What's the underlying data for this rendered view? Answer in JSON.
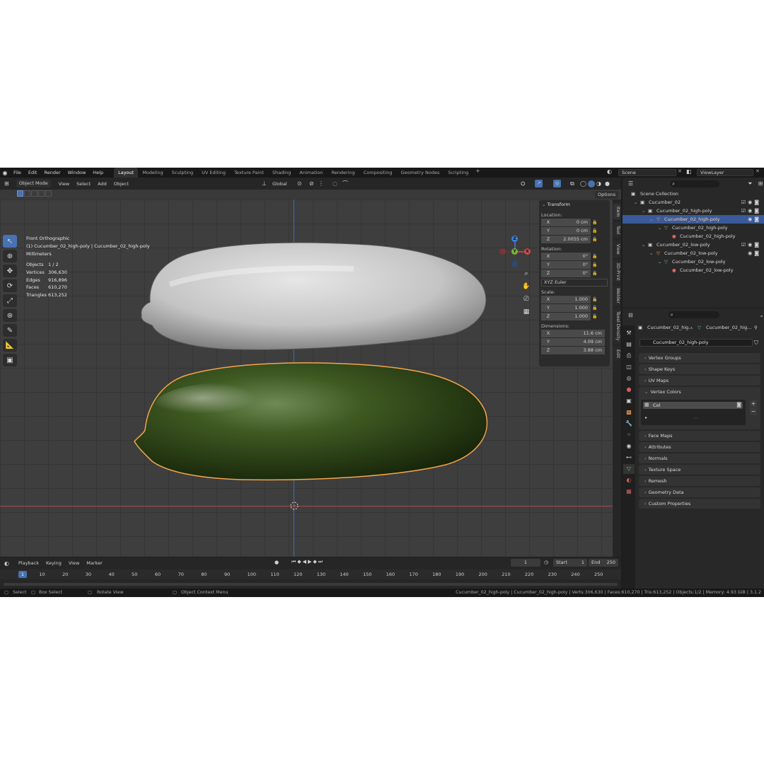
{
  "topbar": {
    "menus": [
      "File",
      "Edit",
      "Render",
      "Window",
      "Help"
    ],
    "workspaces": [
      {
        "label": "Layout",
        "active": true
      },
      {
        "label": "Modeling",
        "active": false
      },
      {
        "label": "Sculpting",
        "active": false
      },
      {
        "label": "UV Editing",
        "active": false
      },
      {
        "label": "Texture Paint",
        "active": false
      },
      {
        "label": "Shading",
        "active": false
      },
      {
        "label": "Animation",
        "active": false
      },
      {
        "label": "Rendering",
        "active": false
      },
      {
        "label": "Compositing",
        "active": false
      },
      {
        "label": "Geometry Nodes",
        "active": false
      },
      {
        "label": "Scripting",
        "active": false
      }
    ],
    "add_tab": "+",
    "scene": "Scene",
    "view_layer": "ViewLayer"
  },
  "viewport_header": {
    "mode": "Object Mode",
    "menus": [
      "View",
      "Select",
      "Add",
      "Object"
    ],
    "orientation": "Global",
    "options": "Options"
  },
  "viewport": {
    "view_name": "Front Orthographic",
    "object_line": "(1) Cucumber_02_high-poly | Cucumber_02_high-poly",
    "units": "Millimeters",
    "stats": [
      {
        "key": "Objects",
        "value": "1 / 2"
      },
      {
        "key": "Vertices",
        "value": "306,630"
      },
      {
        "key": "Edges",
        "value": "916,896"
      },
      {
        "key": "Faces",
        "value": "610,270"
      },
      {
        "key": "Triangles",
        "value": "613,252"
      }
    ],
    "gizmo": {
      "z": "Z",
      "x": "X",
      "y": "Y"
    }
  },
  "npanel": {
    "title": "Transform",
    "location_label": "Location:",
    "location": [
      {
        "axis": "X",
        "value": "0 cm"
      },
      {
        "axis": "Y",
        "value": "0 cm"
      },
      {
        "axis": "Z",
        "value": "2.0055 cm"
      }
    ],
    "rotation_label": "Rotation:",
    "rotation": [
      {
        "axis": "X",
        "value": "0°"
      },
      {
        "axis": "Y",
        "value": "0°"
      },
      {
        "axis": "Z",
        "value": "0°"
      }
    ],
    "rotation_mode": "XYZ Euler",
    "scale_label": "Scale:",
    "scale": [
      {
        "axis": "X",
        "value": "1.000"
      },
      {
        "axis": "Y",
        "value": "1.000"
      },
      {
        "axis": "Z",
        "value": "1.000"
      }
    ],
    "dimensions_label": "Dimensions:",
    "dimensions": [
      {
        "axis": "X",
        "value": "11.6 cm"
      },
      {
        "axis": "Y",
        "value": "4.09 cm"
      },
      {
        "axis": "Z",
        "value": "3.88 cm"
      }
    ],
    "tabs": [
      "Item",
      "Tool",
      "View",
      "3D-Print",
      "Welder",
      "Texel Density",
      "Edit"
    ]
  },
  "timeline": {
    "menus": [
      "Playback",
      "Keying",
      "View",
      "Marker"
    ],
    "current_frame": "1",
    "start_label": "Start",
    "start": "1",
    "end_label": "End",
    "end": "250",
    "ticks": [
      "1",
      "10",
      "20",
      "30",
      "40",
      "50",
      "60",
      "70",
      "80",
      "90",
      "100",
      "110",
      "120",
      "130",
      "140",
      "150",
      "160",
      "170",
      "180",
      "190",
      "200",
      "210",
      "220",
      "230",
      "240",
      "250"
    ]
  },
  "statusbar": {
    "select": "Select",
    "box_select": "Box Select",
    "rotate_view": "Rotate View",
    "context_menu": "Object Context Menu",
    "info": "Cucumber_02_high-poly | Cucumber_02_high-poly | Verts:306,630 | Faces:610,270 | Tris:613,252 | Objects:1/2 | Memory: 4.93 GiB | 3.1.2"
  },
  "outliner": {
    "rows": [
      {
        "label": "Scene Collection"
      },
      {
        "label": "Cucumber_02"
      },
      {
        "label": "Cucumber_02_high-poly"
      },
      {
        "label": "Cucumber_02_high-poly"
      },
      {
        "label": "Cucumber_02_high-poly"
      },
      {
        "label": "Cucumber_02_high-poly"
      },
      {
        "label": "Cucumber_02_low-poly"
      },
      {
        "label": "Cucumber_02_low-poly"
      },
      {
        "label": "Cucumber_02_low-poly"
      },
      {
        "label": "Cucumber_02_low-poly"
      }
    ]
  },
  "properties": {
    "breadcrumb_object": "Cucumber_02_hig...",
    "breadcrumb_mesh": "Cucumber_02_hig...",
    "mesh_name": "Cucumber_02_high-poly",
    "panels": [
      "Vertex Groups",
      "Shape Keys",
      "UV Maps",
      "Vertex Colors",
      "Face Maps",
      "Attributes",
      "Normals",
      "Texture Space",
      "Remesh",
      "Geometry Data",
      "Custom Properties"
    ],
    "vertex_color_item": "Col"
  },
  "colors": {
    "accent": "#4772b3",
    "selection_outline": "#f5a54a",
    "axis_x": "#b04848",
    "axis_z": "#3e6fa6"
  }
}
